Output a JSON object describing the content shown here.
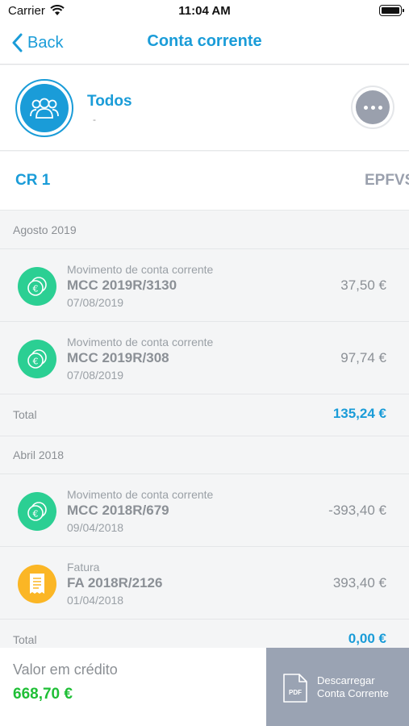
{
  "status_bar": {
    "carrier": "Carrier",
    "time": "11:04 AM"
  },
  "nav": {
    "back_label": "Back",
    "title": "Conta corrente"
  },
  "entity": {
    "name": "Todos",
    "subtitle": "-"
  },
  "tabs": {
    "left": "CR 1",
    "right": "EPFVS"
  },
  "sections": [
    {
      "header": "Agosto 2019",
      "rows": [
        {
          "type": "Movimento de conta corrente",
          "doc": "MCC 2019R/3130",
          "date": "07/08/2019",
          "amount": "37,50 €",
          "icon": "euro-coins-icon"
        },
        {
          "type": "Movimento de conta corrente",
          "doc": "MCC 2019R/308",
          "date": "07/08/2019",
          "amount": "97,74 €",
          "icon": "euro-coins-icon"
        }
      ],
      "total_label": "Total",
      "total_value": "135,24 €"
    },
    {
      "header": "Abril 2018",
      "rows": [
        {
          "type": "Movimento de conta corrente",
          "doc": "MCC 2018R/679",
          "date": "09/04/2018",
          "amount": "-393,40 €",
          "icon": "euro-coins-icon"
        },
        {
          "type": "Fatura",
          "doc": "FA 2018R/2126",
          "date": "01/04/2018",
          "amount": "393,40 €",
          "icon": "invoice-icon"
        }
      ],
      "total_label": "Total",
      "total_value": "0,00 €"
    }
  ],
  "footer": {
    "credit_label": "Valor em crédito",
    "credit_value": "668,70 €",
    "download_line1": "Descarregar",
    "download_line2": "Conta Corrente",
    "pdf_badge": "PDF"
  },
  "colors": {
    "accent": "#1a9cd8",
    "green_icon": "#2bcf93",
    "yellow_icon": "#fbb625",
    "credit_green": "#1fbf36",
    "download_bg": "#9aa3b3"
  }
}
